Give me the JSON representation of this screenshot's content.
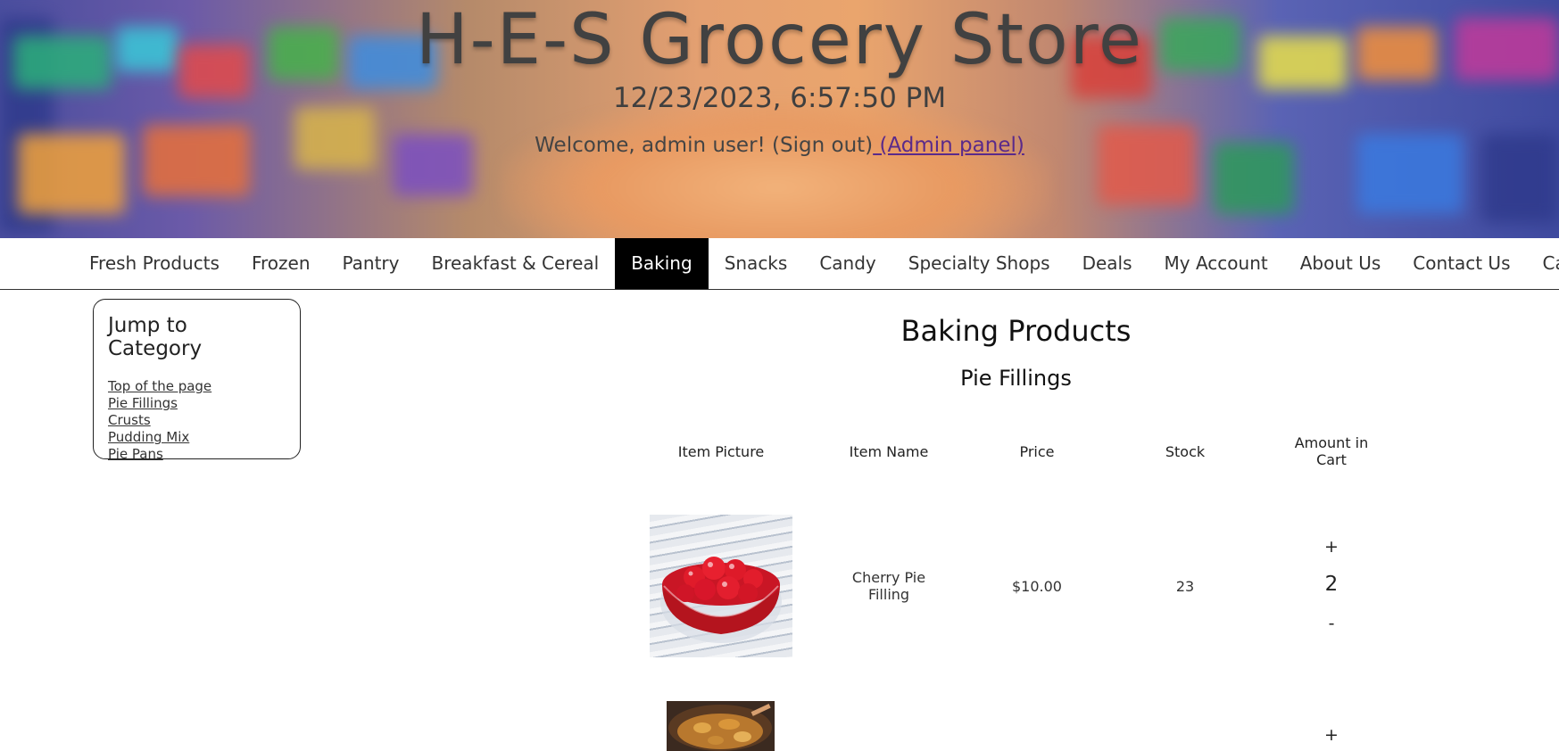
{
  "header": {
    "title": "H-E-S Grocery Store",
    "datetime": "12/23/2023, 6:57:50 PM",
    "welcome_text": "Welcome, admin user! (Sign out)",
    "admin_link": " (Admin panel)"
  },
  "nav": {
    "items": [
      "Fresh Products",
      "Frozen",
      "Pantry",
      "Breakfast & Cereal",
      "Baking",
      "Snacks",
      "Candy",
      "Specialty Shops",
      "Deals",
      "My Account",
      "About Us",
      "Contact Us",
      "Cart"
    ],
    "active": "Baking"
  },
  "sidebar": {
    "title": "Jump to Category",
    "links": [
      "Top of the page",
      "Pie Fillings",
      "Crusts",
      "Pudding Mix",
      "Pie Pans"
    ]
  },
  "main": {
    "page_title": "Baking Products",
    "section_title": "Pie Fillings",
    "columns": [
      "Item Picture",
      "Item Name",
      "Price",
      "Stock",
      "Amount in Cart"
    ],
    "rows": [
      {
        "name": "Cherry Pie Filling",
        "price": "$10.00",
        "stock": "23",
        "qty": "2",
        "plus": "+",
        "minus": "-"
      },
      {
        "plus": "+"
      }
    ]
  },
  "colors": {
    "nav_active_bg": "#000000",
    "admin_link": "#5a2a8a"
  }
}
